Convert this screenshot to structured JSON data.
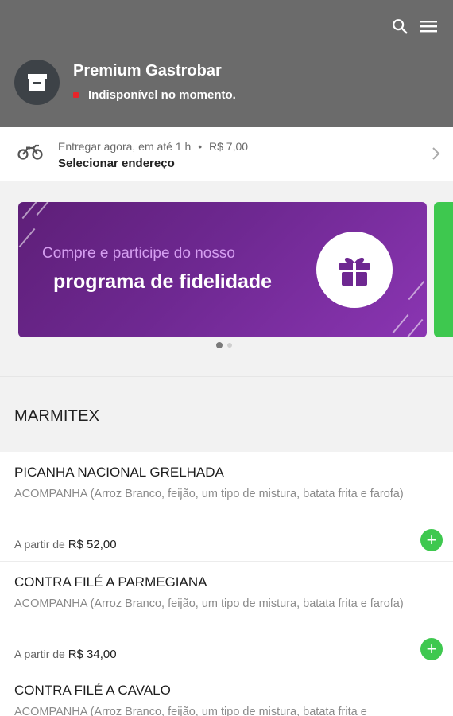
{
  "store": {
    "name": "Premium Gastrobar",
    "status": "Indisponível no momento.",
    "status_color": "#e8242a"
  },
  "header": {
    "background": "#6b6b6b",
    "icons": [
      "search-icon",
      "menu-icon"
    ]
  },
  "delivery": {
    "eta": "Entregar agora, em até 1 h",
    "separator": "•",
    "fee": "R$ 7,00",
    "address_prompt": "Selecionar endereço"
  },
  "banner": {
    "line1": "Compre e participe do nosso",
    "line2": "programa de fidelidade",
    "icon": "gift-icon",
    "color": "#6e2891",
    "total_slides": 2,
    "active_slide": 1
  },
  "section": {
    "title": "MARMITEX"
  },
  "items": [
    {
      "name": "PICANHA NACIONAL GRELHADA",
      "description": "ACOMPANHA (Arroz Branco, feijão, um tipo de mistura, batata frita e farofa)",
      "price_prefix": "A partir de",
      "price": "R$ 52,00",
      "add_label": "+"
    },
    {
      "name": "CONTRA FILÉ A PARMEGIANA",
      "description": "ACOMPANHA (Arroz Branco, feijão, um tipo de mistura, batata frita e farofa)",
      "price_prefix": "A partir de",
      "price": "R$ 34,00",
      "add_label": "+"
    },
    {
      "name": "CONTRA FILÉ A CAVALO",
      "description": "ACOMPANHA (Arroz Branco, feijão, um tipo de mistura, batata frita e"
    }
  ],
  "accent_color": "#3ec84f"
}
